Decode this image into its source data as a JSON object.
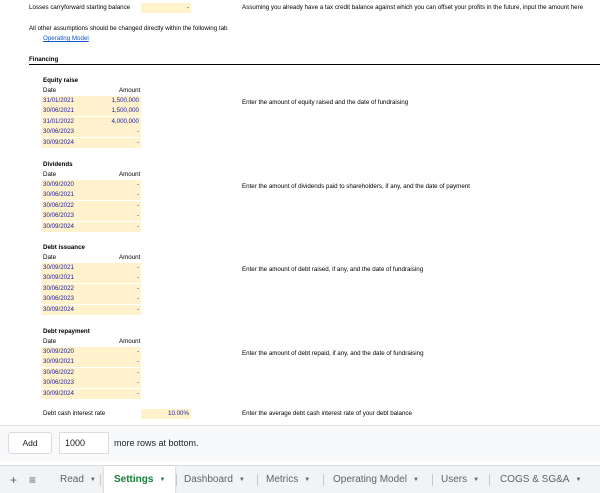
{
  "top": {
    "losses_label": "Losses carryforward starting balance",
    "losses_value": "-",
    "losses_note": "Assuming you already have a tax credit balance against which you can offset your profits in the future, input the amount here",
    "assumptions_note": "All other assumptions should be changed directly within the following tab",
    "operating_model_link": "Operating Model"
  },
  "financing": {
    "title": "Financing",
    "date_header": "Date",
    "amount_header": "Amount",
    "sections": [
      {
        "title": "Equity raise",
        "note": "Enter the amount of equity raised and the date of fundraising",
        "rows": [
          {
            "date": "31/01/2021",
            "amount": "1,500,000"
          },
          {
            "date": "30/06/2021",
            "amount": "1,500,000"
          },
          {
            "date": "31/01/2022",
            "amount": "4,000,000"
          },
          {
            "date": "30/06/2023",
            "amount": "-"
          },
          {
            "date": "30/09/2024",
            "amount": "-"
          }
        ]
      },
      {
        "title": "Dividends",
        "note": "Enter the amount of dividends paid to shareholders, if any, and the date of payment",
        "rows": [
          {
            "date": "30/09/2020",
            "amount": "-"
          },
          {
            "date": "30/06/2021",
            "amount": "-"
          },
          {
            "date": "30/06/2022",
            "amount": "-"
          },
          {
            "date": "30/06/2023",
            "amount": "-"
          },
          {
            "date": "30/09/2024",
            "amount": "-"
          }
        ]
      },
      {
        "title": "Debt issuance",
        "note": "Enter the amount of debt raised, if any, and the date of fundraising",
        "rows": [
          {
            "date": "30/09/2021",
            "amount": "-"
          },
          {
            "date": "30/09/2021",
            "amount": "-"
          },
          {
            "date": "30/06/2022",
            "amount": "-"
          },
          {
            "date": "30/06/2023",
            "amount": "-"
          },
          {
            "date": "30/09/2024",
            "amount": "-"
          }
        ]
      },
      {
        "title": "Debt repayment",
        "note": "Enter the amount of debt repaid, if any, and the date of fundraising",
        "rows": [
          {
            "date": "30/09/2020",
            "amount": "-"
          },
          {
            "date": "30/09/2021",
            "amount": "-"
          },
          {
            "date": "30/06/2022",
            "amount": "-"
          },
          {
            "date": "30/06/2023",
            "amount": "-"
          },
          {
            "date": "30/09/2024",
            "amount": "-"
          }
        ]
      }
    ],
    "interest_label": "Debt cash interest rate",
    "interest_value": "10.00%",
    "interest_note": "Enter the average debt cash interest rate of your debt balance"
  },
  "add_rows": {
    "button": "Add",
    "count": "1000",
    "suffix": "more rows at bottom."
  },
  "tabs": {
    "add_icon": "+",
    "list_icon": "≡",
    "caret": "▼",
    "items": [
      {
        "label": "Read"
      },
      {
        "label": "Settings"
      },
      {
        "label": "Dashboard"
      },
      {
        "label": "Metrics"
      },
      {
        "label": "Operating Model"
      },
      {
        "label": "Users"
      },
      {
        "label": "COGS & SG&A"
      }
    ],
    "active_color": "#188038"
  },
  "colors": {
    "input_cell": "#fff2cc",
    "input_text": "#1a1aa6",
    "link": "#1155cc"
  }
}
